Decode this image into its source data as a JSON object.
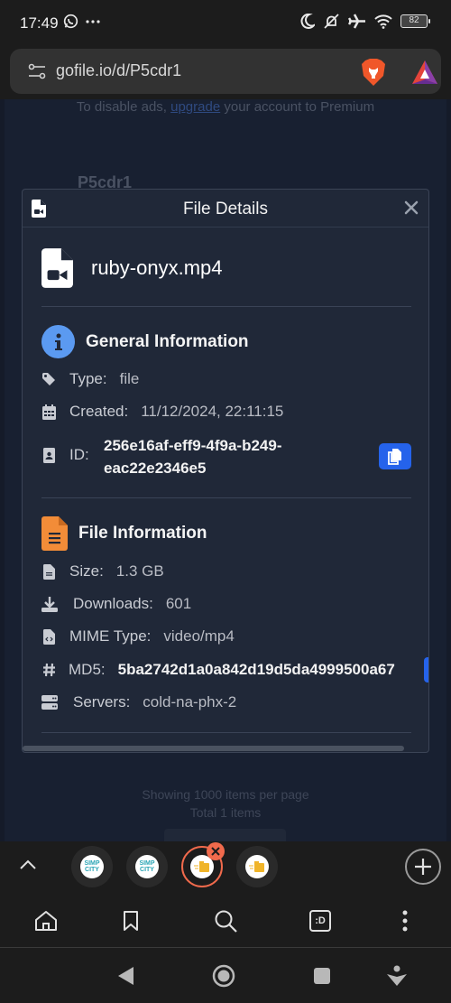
{
  "status_bar": {
    "time": "17:49",
    "battery": "82",
    "left_icons": [
      "whatsapp-icon",
      "more-notifications-icon"
    ],
    "right_icons": [
      "moon-icon",
      "muted-bell-icon",
      "airplane-icon",
      "wifi-icon",
      "battery-icon"
    ]
  },
  "browser": {
    "url": "gofile.io/d/P5cdr1",
    "tabs": [
      {
        "name": "simpcity-tab",
        "favicon": "SIMP CITY"
      },
      {
        "name": "simpcity-tab-2",
        "favicon": "SIMP CITY"
      },
      {
        "name": "gofile-tab",
        "favicon": "gofile",
        "active": true
      },
      {
        "name": "gofile-tab-2",
        "favicon": "gofile"
      }
    ],
    "toolbar": [
      "home",
      "bookmarks",
      "search",
      "tab-switcher",
      "menu"
    ],
    "tab_switcher_label": ":D"
  },
  "page": {
    "ad_prefix": "To disable ads, ",
    "ad_link": "upgrade",
    "ad_suffix": " your account to Premium",
    "folder_title": "P5cdr1",
    "showing": "Showing 1000 items per page",
    "total": "Total 1 items"
  },
  "modal": {
    "title": "File Details",
    "file_name": "ruby-onyx.mp4",
    "general": {
      "title": "General Information",
      "type_label": "Type:",
      "type_value": "file",
      "created_label": "Created:",
      "created_value": "11/12/2024, 22:11:15",
      "id_label": "ID:",
      "id_value": "256e16af-eff9-4f9a-b249-eac22e2346e5"
    },
    "file": {
      "title": "File Information",
      "size_label": "Size:",
      "size_value": "1.3 GB",
      "downloads_label": "Downloads:",
      "downloads_value": "601",
      "mime_label": "MIME Type:",
      "mime_value": "video/mp4",
      "md5_label": "MD5:",
      "md5_value": "5ba2742d1a0a842d19d5da4999500a67",
      "servers_label": "Servers:",
      "servers_value": "cold-na-phx-2"
    }
  },
  "colors": {
    "accent_blue": "#2563eb",
    "info_blue": "#5b9af1",
    "file_orange": "#f28c38",
    "active_tab": "#f06a4c"
  }
}
